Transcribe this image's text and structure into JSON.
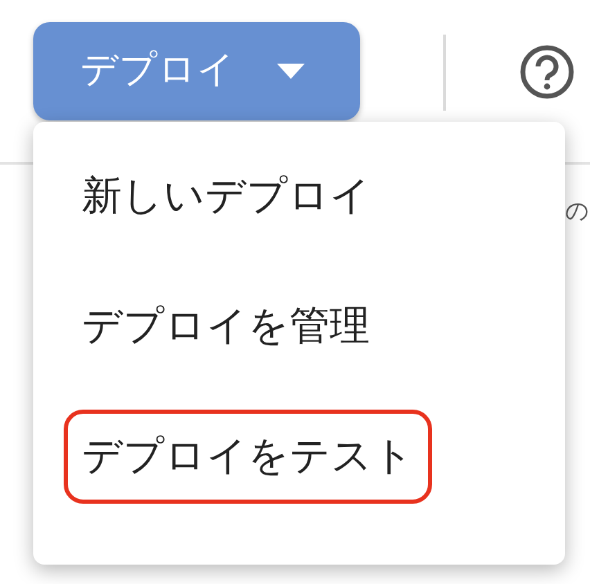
{
  "deploy_button": {
    "label": "デプロイ"
  },
  "background_text": "の",
  "menu": {
    "items": [
      {
        "label": "新しいデプロイ",
        "highlighted": false
      },
      {
        "label": "デプロイを管理",
        "highlighted": false
      },
      {
        "label": "デプロイをテスト",
        "highlighted": true
      }
    ]
  }
}
